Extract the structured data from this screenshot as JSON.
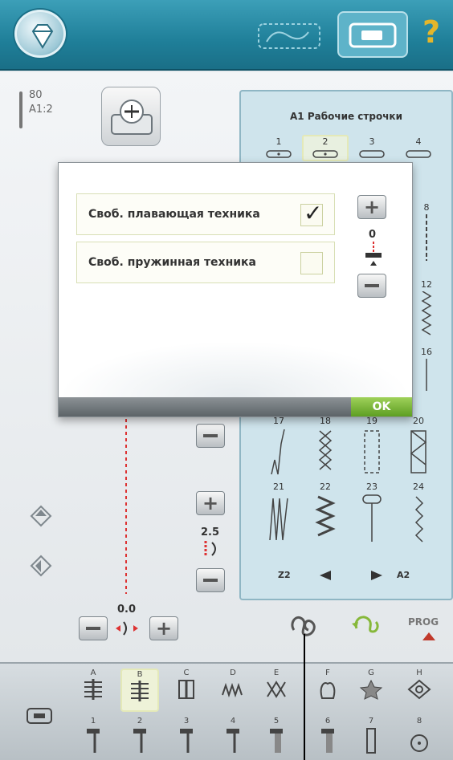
{
  "needle": {
    "size": "80",
    "code": "A1:2"
  },
  "stitch_panel": {
    "title": "A1 Рабочие строчки",
    "row1": [
      "1",
      "2",
      "3",
      "4"
    ],
    "row_right": [
      "8",
      "12",
      "16"
    ],
    "row_lower": [
      "17",
      "18",
      "19",
      "20"
    ],
    "row_bottom": [
      "21",
      "22",
      "23",
      "24"
    ],
    "nav_prev": "Z2",
    "nav_next": "A2"
  },
  "dialog": {
    "options": [
      {
        "label": "Своб. плавающая техника",
        "checked": true,
        "mark": "✓"
      },
      {
        "label": "Своб. пружинная техника",
        "checked": false,
        "mark": ""
      }
    ],
    "value": "0",
    "ok_label": "OK"
  },
  "controls": {
    "stitch_length": "2.5",
    "stitch_width": "0.0",
    "prog_label": "PROG"
  },
  "categories": {
    "top": [
      "A",
      "B",
      "C",
      "D",
      "E",
      "F",
      "G",
      "H"
    ],
    "bottom": [
      "1",
      "2",
      "3",
      "4",
      "5",
      "6",
      "7",
      "8"
    ],
    "selected": "B"
  },
  "colors": {
    "accent_teal": "#1f7f99",
    "ok_green": "#5d9e22",
    "help_yellow": "#e4b62b",
    "prog_red": "#c0392b"
  }
}
